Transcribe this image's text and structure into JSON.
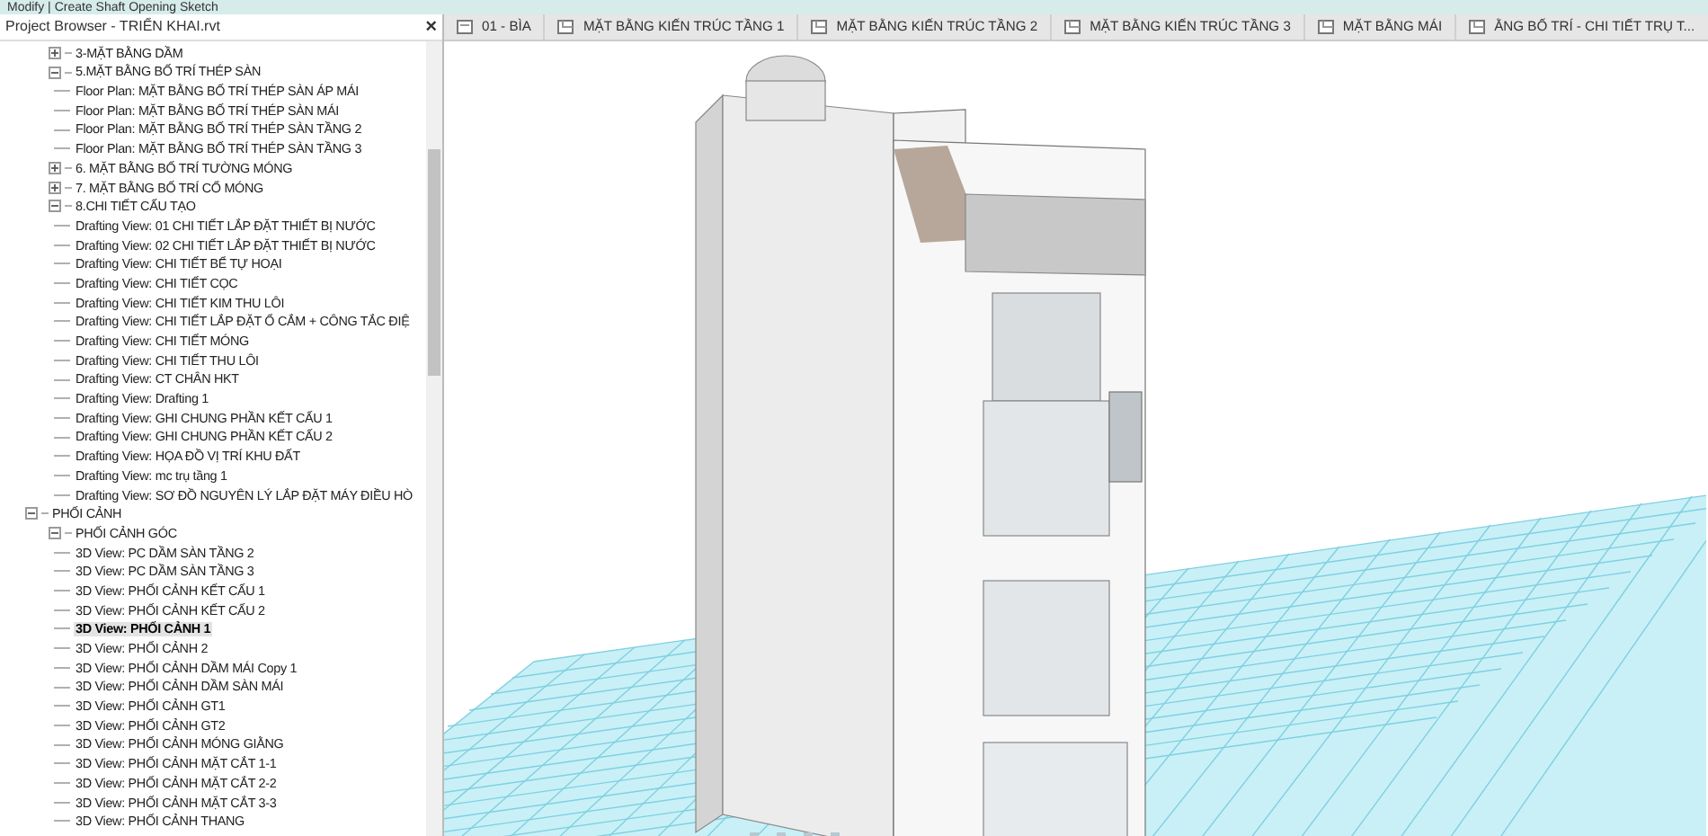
{
  "ribbon": {
    "context": "Modify | Create Shaft Opening Sketch"
  },
  "project_browser": {
    "title": "Project Browser - TRIỂN KHAI.rvt",
    "close": "×",
    "continued_items": [
      {
        "label": "3-MẶT BẰNG DẦM",
        "expanded": false
      },
      {
        "label": "5.MẶT BẰNG BỐ TRÍ THÉP SÀN",
        "expanded": true,
        "children": [
          {
            "label": "Floor Plan: MẶT BẰNG BỐ TRÍ THÉP SÀN ÁP MÁI",
            "selected": false
          },
          {
            "label": "Floor Plan: MẶT BẰNG BỐ TRÍ THÉP SÀN MÁI",
            "selected": false
          },
          {
            "label": "Floor Plan: MẶT BẰNG BỐ TRÍ THÉP SÀN TẦNG 2",
            "selected": false
          },
          {
            "label": "Floor Plan: MẶT BẰNG BỐ TRÍ THÉP SÀN TẦNG 3",
            "selected": false
          }
        ]
      },
      {
        "label": "6. MẶT BẰNG BỐ TRÍ TƯỜNG MÓNG",
        "expanded": false
      },
      {
        "label": "7. MẶT BẰNG BỐ TRÍ CỔ MÓNG",
        "expanded": false
      },
      {
        "label": "8.CHI TIẾT CẤU TẠO",
        "expanded": true,
        "children": [
          {
            "label": "Drafting View: 01 CHI TIẾT LẮP ĐẶT THIẾT BỊ NƯỚC",
            "selected": false
          },
          {
            "label": "Drafting View: 02 CHI TIẾT LẮP ĐẶT THIẾT BỊ NƯỚC",
            "selected": false
          },
          {
            "label": "Drafting View: CHI TIẾT BỂ TỰ HOẠI",
            "selected": false
          },
          {
            "label": "Drafting View: CHI TIẾT CỌC",
            "selected": false
          },
          {
            "label": "Drafting View: CHI TIẾT KIM THU LÔI",
            "selected": false
          },
          {
            "label": "Drafting View: CHI TIẾT LẮP ĐẶT Ổ CẮM + CÔNG TẮC ĐIỆ",
            "selected": false
          },
          {
            "label": "Drafting View: CHI TIẾT MÓNG",
            "selected": false
          },
          {
            "label": "Drafting View: CHI TIẾT THU LÔI",
            "selected": false
          },
          {
            "label": "Drafting View: CT CHÂN HKT",
            "selected": false
          },
          {
            "label": "Drafting View: Drafting 1",
            "selected": false
          },
          {
            "label": "Drafting View: GHI CHUNG PHẦN KẾT CẤU 1",
            "selected": false
          },
          {
            "label": "Drafting View: GHI CHUNG PHẦN KẾT CẤU 2",
            "selected": false
          },
          {
            "label": "Drafting View: HỌA ĐỒ VỊ TRÍ KHU ĐẤT",
            "selected": false
          },
          {
            "label": "Drafting View: mc trụ tầng 1",
            "selected": false
          },
          {
            "label": "Drafting View: SƠ ĐỒ NGUYÊN LÝ LẮP ĐẶT MÁY ĐIỀU HÒ",
            "selected": false
          }
        ]
      }
    ],
    "items": [
      {
        "label": "PHỐI CẢNH",
        "expanded": true,
        "children": [
          {
            "label": "PHỐI CẢNH GÓC",
            "expanded": true,
            "children": [
              {
                "label": "3D View: PC DẦM SÀN TẦNG 2",
                "selected": false
              },
              {
                "label": "3D View: PC DẦM SÀN TẦNG 3",
                "selected": false
              },
              {
                "label": "3D View: PHỐI CẢNH KẾT CẤU 1",
                "selected": false
              },
              {
                "label": "3D View: PHỐI CẢNH KẾT CẤU 2",
                "selected": false
              },
              {
                "label": "3D View: PHỐI CẢNH 1",
                "selected": true
              },
              {
                "label": "3D View: PHỐI CẢNH 2",
                "selected": false
              },
              {
                "label": "3D View: PHỐI CẢNH DẦM MÁI Copy 1",
                "selected": false
              },
              {
                "label": "3D View: PHỐI CẢNH DẦM SÀN MÁI",
                "selected": false
              },
              {
                "label": "3D View: PHỐI CẢNH GT1",
                "selected": false
              },
              {
                "label": "3D View: PHỐI CẢNH GT2",
                "selected": false
              },
              {
                "label": "3D View: PHỐI CẢNH MÓNG GIẰNG",
                "selected": false
              },
              {
                "label": "3D View: PHỐI CẢNH MẶT CẮT 1-1",
                "selected": false
              },
              {
                "label": "3D View: PHỐI CẢNH MẶT CẮT 2-2",
                "selected": false
              },
              {
                "label": "3D View: PHỐI CẢNH MẶT CẮT 3-3",
                "selected": false
              },
              {
                "label": "3D View: PHỐI CẢNH THANG",
                "selected": false
              }
            ]
          }
        ]
      }
    ]
  },
  "view_tabs": [
    {
      "label": "01 - BÌA",
      "kind": "sheet"
    },
    {
      "label": "MẶT BẰNG KIẾN TRÚC TẦNG 1",
      "kind": "plan"
    },
    {
      "label": "MẶT BẰNG KIẾN TRÚC TẦNG 2",
      "kind": "plan"
    },
    {
      "label": "MẶT BẰNG KIẾN TRÚC TẦNG 3",
      "kind": "plan"
    },
    {
      "label": "MẶT BẰNG MÁI",
      "kind": "plan"
    },
    {
      "label": "ẰNG BỐ TRÍ - CHI TIẾT TRỤ T...",
      "kind": "plan"
    }
  ]
}
